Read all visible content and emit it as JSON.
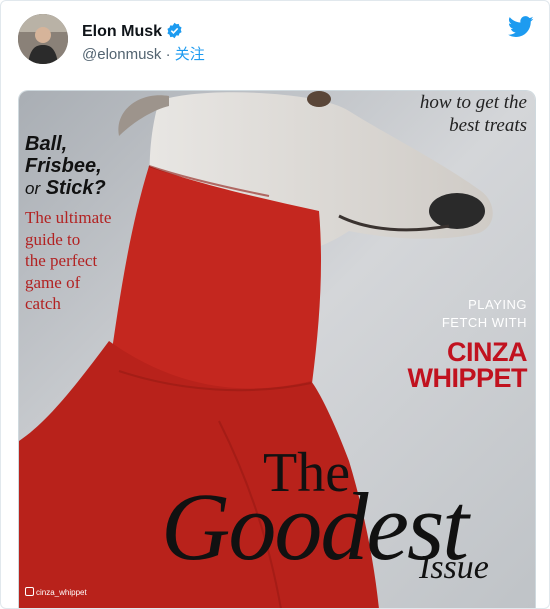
{
  "tweet": {
    "display_name": "Elon Musk",
    "handle": "@elonmusk",
    "separator": "·",
    "follow_label": "关注",
    "verified": true,
    "platform_icon": "twitter-bird-icon",
    "brand_color": "#1d9bf0"
  },
  "media": {
    "cover": {
      "howto_line1": "how to get the",
      "howto_line2": "best treats",
      "ball_line1": "Ball,",
      "ball_line2": "Frisbee,",
      "ball_or": "or",
      "ball_line3": "Stick?",
      "guide_line1": "The ultimate",
      "guide_line2": "guide to",
      "guide_line3": "the perfect",
      "guide_line4": "game of",
      "guide_line5": "catch",
      "playing_line1": "PLAYING",
      "playing_line2": "FETCH WITH",
      "cinza_line1": "CINZA",
      "cinza_line2": "WHIPPET",
      "the": "The",
      "goodest": "Goodest",
      "issue": "Issue",
      "credit": "cinza_whippet"
    },
    "colors": {
      "sweater": "#c4271f",
      "headline_red": "#c1121f",
      "background": "#c9ccd0"
    }
  }
}
